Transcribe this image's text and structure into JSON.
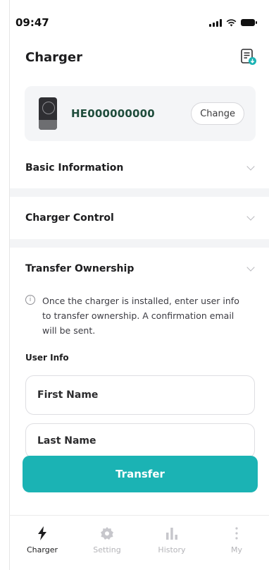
{
  "status_bar": {
    "time": "09:47"
  },
  "header": {
    "title": "Charger",
    "doc_icon": "document-download-icon"
  },
  "charger_card": {
    "serial": "HE000000000",
    "change_label": "Change"
  },
  "sections": [
    {
      "title": "Basic Information"
    },
    {
      "title": "Charger Control"
    },
    {
      "title": "Transfer Ownership"
    }
  ],
  "transfer": {
    "info_text": "Once the charger is installed, enter user info to transfer ownership. A confirmation email will be sent.",
    "user_info_label": "User Info",
    "first_name_placeholder": "First Name",
    "last_name_placeholder": "Last Name",
    "button_label": "Transfer"
  },
  "tabs": [
    {
      "label": "Charger",
      "icon": "lightning-icon",
      "active": true
    },
    {
      "label": "Setting",
      "icon": "gear-icon",
      "active": false
    },
    {
      "label": "History",
      "icon": "bar-chart-icon",
      "active": false
    },
    {
      "label": "My",
      "icon": "more-vertical-icon",
      "active": false
    }
  ],
  "colors": {
    "accent": "#1bb3b4",
    "serial": "#1f4d3c",
    "inactive_tab": "#b4b4b8"
  }
}
